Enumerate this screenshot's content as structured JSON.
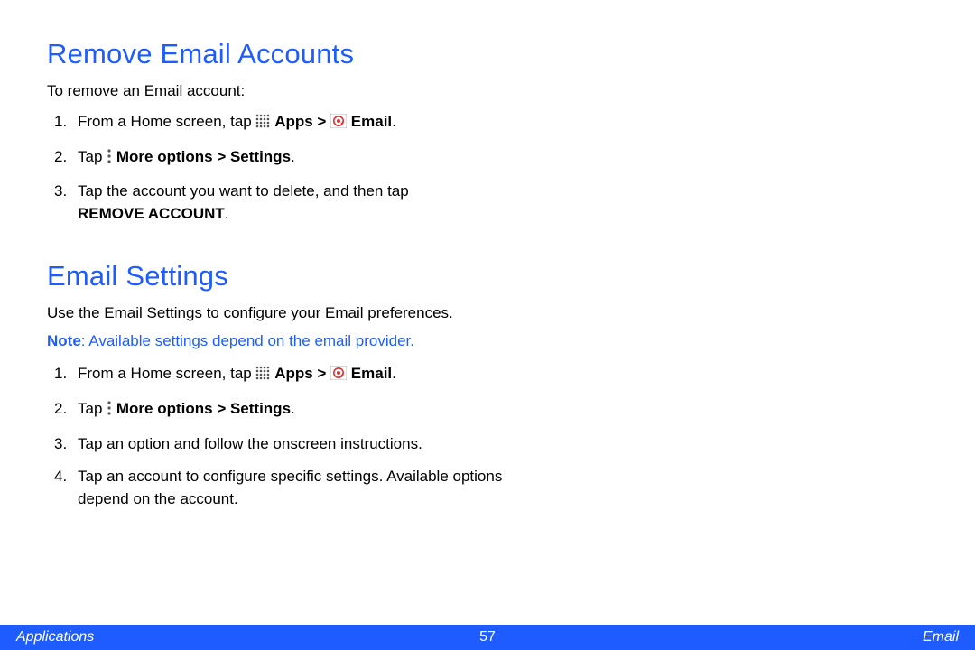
{
  "section1": {
    "heading": "Remove Email Accounts",
    "intro": "To remove an Email account:",
    "step1_prefix": "From a Home screen, tap ",
    "step1_apps": "Apps > ",
    "step1_email": " Email",
    "step2_prefix": "Tap ",
    "step2_bold": "More options > Settings",
    "step3_line1": "Tap the account you want to delete, and then tap",
    "step3_bold": "REMOVE ACCOUNT"
  },
  "section2": {
    "heading": "Email Settings",
    "intro": "Use the Email Settings to configure your Email preferences.",
    "note_label": "Note",
    "note_text": ": Available settings depend on the email provider.",
    "step1_prefix": "From a Home screen, tap ",
    "step1_apps": "Apps > ",
    "step1_email": " Email",
    "step2_prefix": "Tap ",
    "step2_bold": "More options > Settings",
    "step3": "Tap an option and follow the onscreen instructions.",
    "step4": "Tap an account to configure specific settings. Available options depend on the account."
  },
  "footer": {
    "left": "Applications",
    "center": "57",
    "right": "Email"
  }
}
